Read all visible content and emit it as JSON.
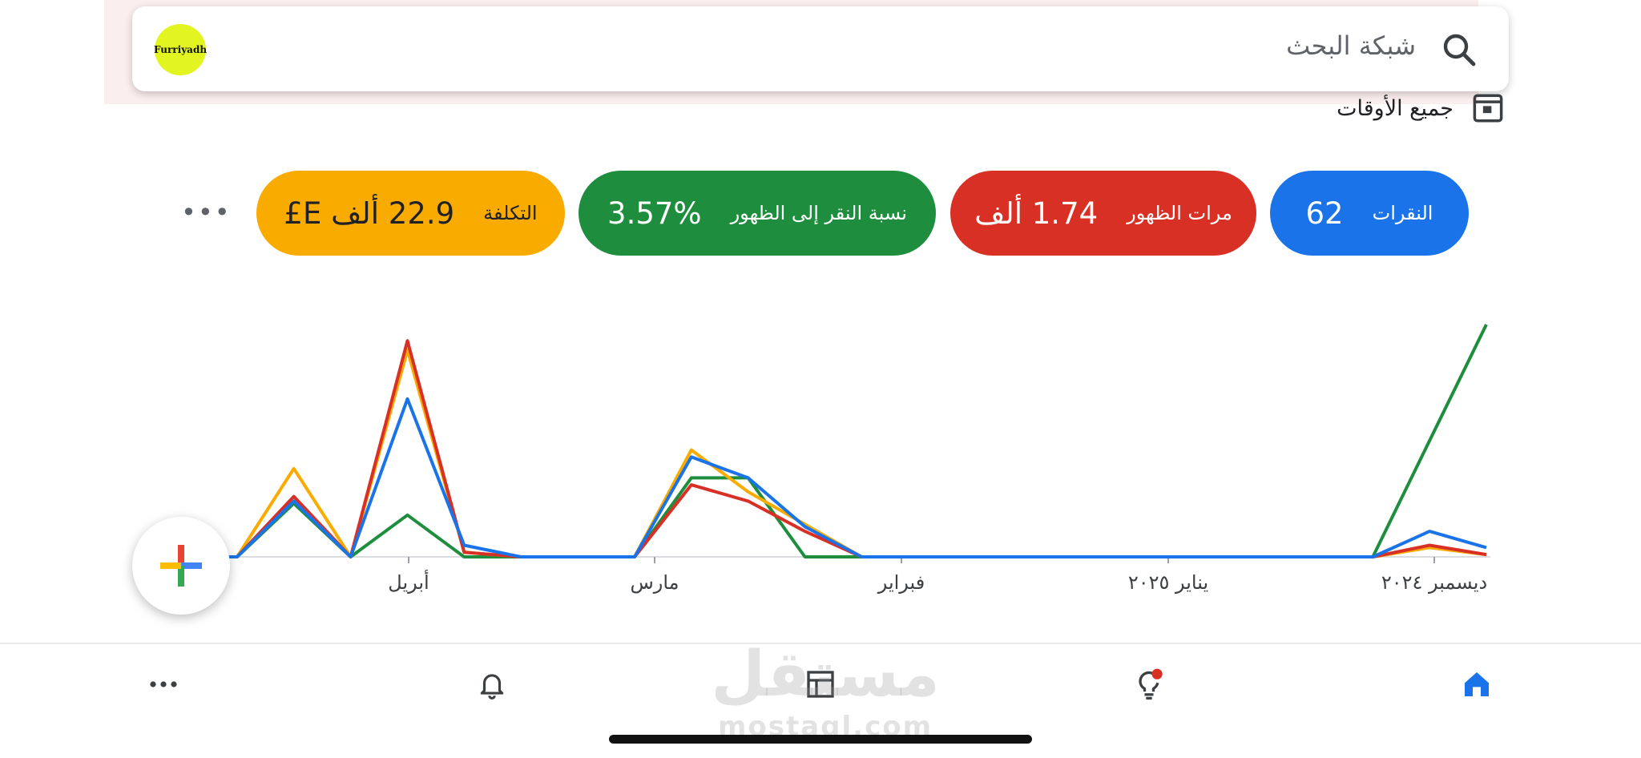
{
  "search": {
    "placeholder": "شبكة البحث",
    "logo_text": "Furriyadh"
  },
  "time_range": {
    "label": "جميع الأوقات"
  },
  "metrics": [
    {
      "label": "النقرات",
      "value": "62",
      "color": "#1a73e8"
    },
    {
      "label": "مرات الظهور",
      "value": "1.74 ألف",
      "color": "#d93025"
    },
    {
      "label": "نسبة النقر إلى الظهور",
      "value": "3.57%",
      "color": "#1e8e3e"
    },
    {
      "label": "التكلفة",
      "value": "22.9 ألف E£",
      "color": "#f9ab00"
    }
  ],
  "more_menu": {
    "icon": "more-horizontal-icon"
  },
  "chart_data": {
    "type": "line",
    "x_tick_labels": [
      "ديسمبر ٢٠٢٤",
      "يناير ٢٠٢٥",
      "فبراير",
      "مارس",
      "أبريل"
    ],
    "x_direction": "rtl",
    "x_points": 24,
    "series": [
      {
        "color": "#1e8e3e",
        "values": [
          100,
          50,
          0,
          0,
          0,
          0,
          0,
          0,
          0,
          0,
          0,
          0,
          0,
          34,
          34,
          0,
          0,
          0,
          0,
          18,
          0,
          23,
          0,
          0
        ]
      },
      {
        "color": "#f9ab00",
        "values": [
          1,
          4,
          0,
          0,
          0,
          0,
          0,
          0,
          0,
          0,
          0,
          0,
          14,
          28,
          46,
          0,
          0,
          0,
          2,
          89,
          0,
          38,
          0,
          0
        ]
      },
      {
        "color": "#d93025",
        "values": [
          1,
          5,
          0,
          0,
          0,
          0,
          0,
          0,
          0,
          0,
          0,
          0,
          11,
          24,
          31,
          0,
          0,
          0,
          2,
          93,
          0,
          26,
          0,
          0
        ]
      },
      {
        "color": "#1a73e8",
        "values": [
          4,
          11,
          0,
          0,
          0,
          0,
          0,
          0,
          0,
          0,
          0,
          0,
          13,
          34,
          43,
          0,
          0,
          0,
          5,
          68,
          0,
          24,
          0,
          0
        ]
      }
    ],
    "grid": false
  },
  "fab": {
    "icon": "plus-icon"
  },
  "bottom_nav": [
    {
      "name": "home",
      "icon": "home-icon"
    },
    {
      "name": "recommendations",
      "icon": "lightbulb-icon"
    },
    {
      "name": "campaigns",
      "icon": "table-icon"
    },
    {
      "name": "notifications",
      "icon": "bell-icon"
    },
    {
      "name": "more",
      "icon": "more-horizontal-icon"
    }
  ],
  "watermark": {
    "text_ar": "مستقل",
    "text_en": "mostaql.com"
  }
}
